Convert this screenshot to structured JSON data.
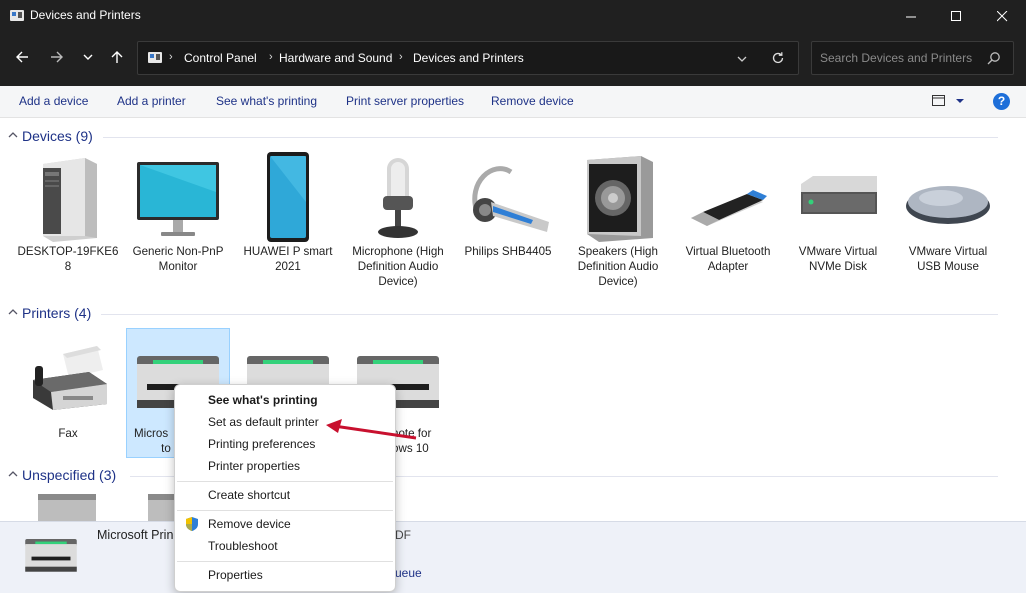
{
  "window": {
    "title": "Devices and Printers"
  },
  "address": {
    "crumbs": [
      "Control Panel",
      "Hardware and Sound",
      "Devices and Printers"
    ],
    "search_placeholder": "Search Devices and Printers"
  },
  "toolbar": {
    "add_device": "Add a device",
    "add_printer": "Add a printer",
    "see_printing": "See what's printing",
    "print_server": "Print server properties",
    "remove_device": "Remove device",
    "help": "?"
  },
  "groups": {
    "devices": "Devices (9)",
    "printers": "Printers (4)",
    "unspecified": "Unspecified (3)"
  },
  "devices": [
    {
      "label": "DESKTOP-19FKE6 8",
      "icon": "computer-tower-icon"
    },
    {
      "label": "Generic Non-PnP Monitor",
      "icon": "monitor-icon"
    },
    {
      "label": "HUAWEI P smart 2021",
      "icon": "phone-icon"
    },
    {
      "label": "Microphone (High Definition Audio Device)",
      "icon": "microphone-icon"
    },
    {
      "label": "Philips SHB4405",
      "icon": "headset-icon"
    },
    {
      "label": "Speakers (High Definition Audio Device)",
      "icon": "speaker-icon"
    },
    {
      "label": "Virtual Bluetooth Adapter",
      "icon": "usb-dongle-icon"
    },
    {
      "label": "VMware Virtual NVMe Disk",
      "icon": "disk-drive-icon"
    },
    {
      "label": "VMware Virtual USB Mouse",
      "icon": "mouse-icon"
    }
  ],
  "printers": [
    {
      "label": "Fax",
      "icon": "fax-icon"
    },
    {
      "label": "Micros",
      "label2": "to",
      "icon": "printer-icon"
    },
    {
      "label": "",
      "icon": "printer-icon"
    },
    {
      "label": "note for",
      "label2": "ows 10",
      "icon": "printer-icon"
    }
  ],
  "details": {
    "name": "Microsoft Prin",
    "model_fragment": "DF",
    "status_fragment": "ueue"
  },
  "context_menu": {
    "items": [
      {
        "label": "See what's printing",
        "bold": true
      },
      {
        "label": "Set as default printer"
      },
      {
        "label": "Printing preferences"
      },
      {
        "label": "Printer properties"
      },
      {
        "label": "Create shortcut"
      },
      {
        "label": "Remove device",
        "icon": "shield-icon"
      },
      {
        "label": "Troubleshoot"
      },
      {
        "label": "Properties"
      }
    ]
  },
  "colors": {
    "accent": "#1e3287",
    "selection": "#cde8ff",
    "arrow": "#c8102e"
  }
}
